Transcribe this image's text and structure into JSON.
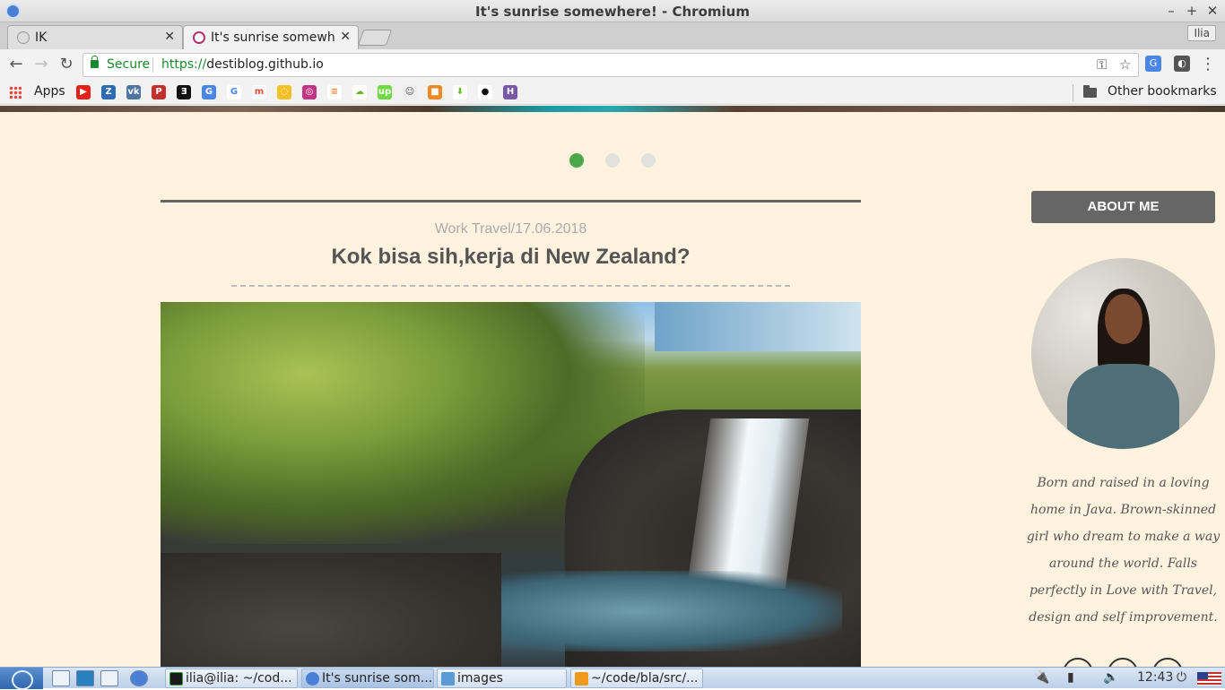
{
  "window": {
    "title": "It's sunrise somewhere! - Chromium"
  },
  "tabs": [
    {
      "label": "IK",
      "active": false
    },
    {
      "label": "It's sunrise somewh",
      "active": true
    }
  ],
  "profile": {
    "label": "Ilia"
  },
  "omnibox": {
    "secure_label": "Secure",
    "scheme": "https://",
    "host": "destiblog.github.io"
  },
  "bookmarks": {
    "apps_label": "Apps",
    "icons": [
      "youtube-icon",
      "icon-2",
      "vk-icon",
      "p-icon",
      "icon-5",
      "translate-icon",
      "google-icon",
      "icon-8",
      "keep-icon",
      "instagram-icon",
      "stackoverflow-icon",
      "icon-12",
      "upwork-icon",
      "icon-14",
      "icon-15",
      "download-icon",
      "github-icon",
      "icon-18"
    ],
    "other_label": "Other bookmarks"
  },
  "page": {
    "slider_dots": 3,
    "active_dot": 0,
    "post_meta": "Work Travel/17.06.2018",
    "post_title": "Kok bisa sih,kerja di New Zealand?",
    "about_label": "ABOUT ME",
    "bio": "Born and raised in a loving home in Java. Brown-skinned girl who dream to make a way around the world. Falls perfectly in Love with Travel, design and self improvement.",
    "colors": {
      "background": "#fff3df",
      "accent": "#4aa84a",
      "button": "#666666"
    }
  },
  "taskbar": {
    "tasks": [
      {
        "label": "ilia@ilia: ~/cod..."
      },
      {
        "label": "It's sunrise som..."
      },
      {
        "label": "images"
      },
      {
        "label": "~/code/bla/src/..."
      }
    ],
    "clock": "12:43"
  }
}
